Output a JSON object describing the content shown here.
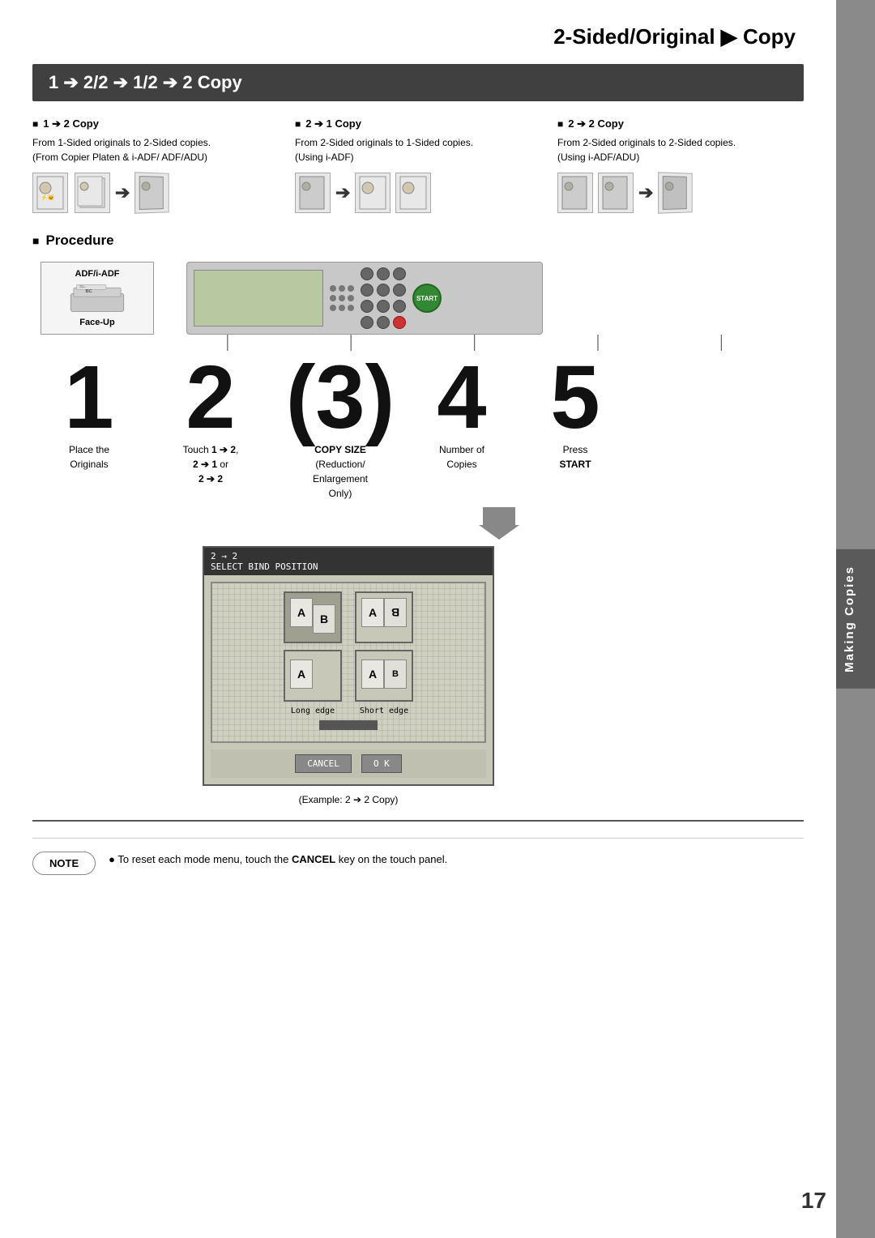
{
  "page": {
    "title": "2-Sided/Original ▶ Copy",
    "section_header": "1 ➔ 2/2 ➔ 1/2 ➔ 2 Copy",
    "page_number": "17",
    "sidebar_label": "Making Copies"
  },
  "copy_types": [
    {
      "title": "1 ➔ 2 Copy",
      "description": "From 1-Sided originals to 2-Sided copies.\n(From Copier Platen & i-ADF/ADF/ADU)"
    },
    {
      "title": "2 ➔ 1 Copy",
      "description": "From 2-Sided originals to 1-Sided copies.\n(Using i-ADF)"
    },
    {
      "title": "2 ➔ 2 Copy",
      "description": "From 2-Sided originals to 2-Sided copies.\n(Using i-ADF/ADU)"
    }
  ],
  "procedure": {
    "title": "Procedure",
    "adf_label_top": "ADF/i-ADF",
    "adf_label_bottom": "Face-Up"
  },
  "steps": [
    {
      "number": "1",
      "description": "Place the\nOriginals"
    },
    {
      "number": "2",
      "description": "Touch 1 ➔ 2,\n2 ➔ 1 or\n2 ➔ 2"
    },
    {
      "number": "(3)",
      "description": "COPY SIZE\n(Reduction/\nEnlargement\nOnly)"
    },
    {
      "number": "4",
      "description": "Number of\nCopies"
    },
    {
      "number": "5",
      "description": "Press\nSTART"
    }
  ],
  "bind_screen": {
    "header_line1": "2 → 2",
    "header_line2": "SELECT BIND POSITION",
    "option1_label": "Long edge",
    "option2_label": "Short edge",
    "cancel_label": "CANCEL",
    "ok_label": "O K"
  },
  "bind_caption": "(Example: 2 ➔ 2 Copy)",
  "note": {
    "label": "NOTE",
    "text": "● To reset each mode menu, touch the CANCEL key on the touch panel."
  }
}
